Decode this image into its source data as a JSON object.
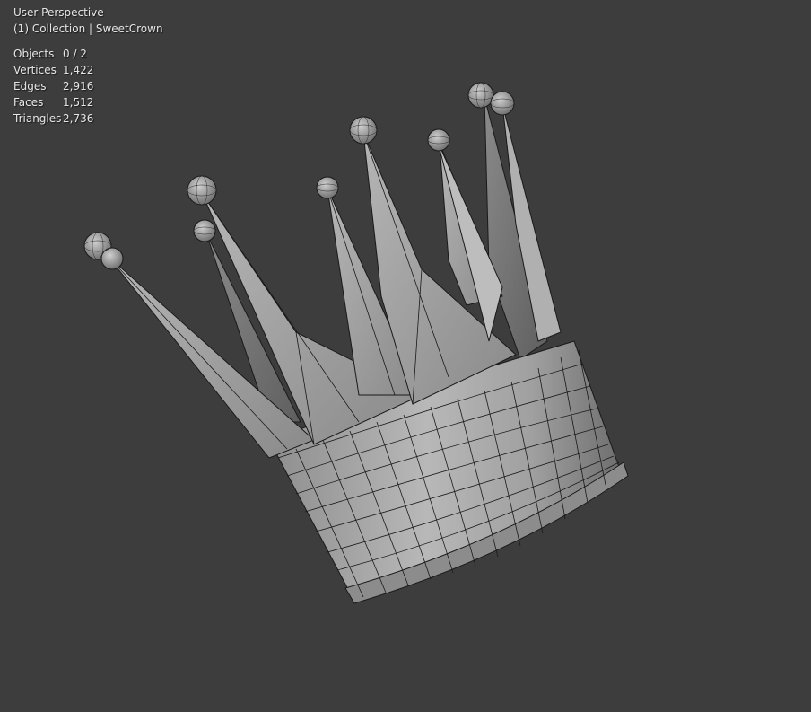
{
  "viewport": {
    "view_name": "User Perspective",
    "collection_info": "(1) Collection | SweetCrown"
  },
  "stats": [
    {
      "label": "Objects",
      "value": "0 / 2"
    },
    {
      "label": "Vertices",
      "value": "1,422"
    },
    {
      "label": "Edges",
      "value": "2,916"
    },
    {
      "label": "Faces",
      "value": "1,512"
    },
    {
      "label": "Triangles",
      "value": "2,736"
    }
  ],
  "colors": {
    "background": "#3d3d3d",
    "mesh_base": "#9a9a9a",
    "mesh_light": "#c4c4c4",
    "mesh_dark": "#6e6e6e",
    "wire": "#1a1a1a"
  },
  "object_name": "SweetCrown"
}
